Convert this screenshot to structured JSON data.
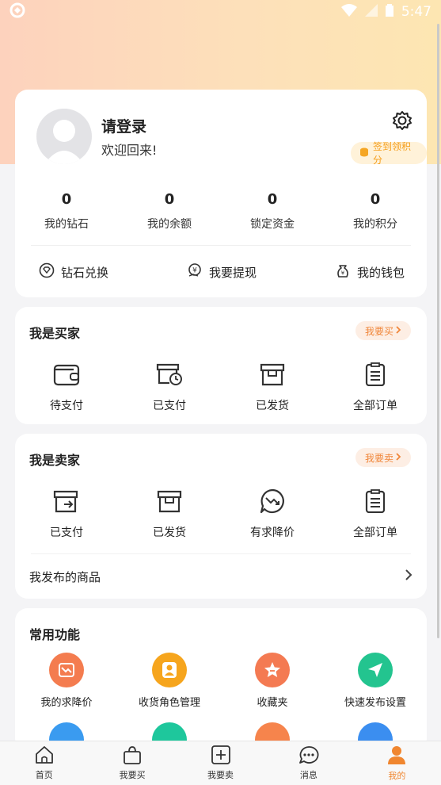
{
  "status": {
    "time": "5:47"
  },
  "user": {
    "login_label": "请登录",
    "welcome_text": "欢迎回来!",
    "sign_badge": "签到领积分",
    "stats": [
      {
        "value": "0",
        "label": "我的钻石"
      },
      {
        "value": "0",
        "label": "我的余额"
      },
      {
        "value": "0",
        "label": "锁定资金"
      },
      {
        "value": "0",
        "label": "我的积分"
      }
    ],
    "actions": [
      {
        "label": "钻石兑换",
        "icon": "diamond-icon"
      },
      {
        "label": "我要提现",
        "icon": "withdraw-icon"
      },
      {
        "label": "我的钱包",
        "icon": "wallet-icon"
      }
    ]
  },
  "buyer": {
    "title": "我是买家",
    "pill": "我要买",
    "items": [
      {
        "label": "待支付",
        "icon": "wallet-icon"
      },
      {
        "label": "已支付",
        "icon": "paid-clock-icon"
      },
      {
        "label": "已发货",
        "icon": "box-icon"
      },
      {
        "label": "全部订单",
        "icon": "order-list-icon"
      }
    ]
  },
  "seller": {
    "title": "我是卖家",
    "pill": "我要卖",
    "items": [
      {
        "label": "已支付",
        "icon": "paid-arrow-icon"
      },
      {
        "label": "已发货",
        "icon": "box-icon"
      },
      {
        "label": "有求降价",
        "icon": "price-drop-icon"
      },
      {
        "label": "全部订单",
        "icon": "order-list-icon"
      }
    ],
    "published_label": "我发布的商品"
  },
  "common": {
    "title": "常用功能",
    "items": [
      {
        "label": "我的求降价",
        "icon": "price-drop-icon",
        "color": "#f47c4f"
      },
      {
        "label": "收货角色管理",
        "icon": "person-icon",
        "color": "#f6a51d"
      },
      {
        "label": "收藏夹",
        "icon": "star-icon",
        "color": "#f47a52"
      },
      {
        "label": "快速发布设置",
        "icon": "send-icon",
        "color": "#23c48f"
      }
    ],
    "row2_colors": [
      "#3a9bf0",
      "#1ec79c",
      "#f6844c",
      "#3b8ef0"
    ]
  },
  "tabbar": {
    "tabs": [
      {
        "label": "首页",
        "icon": "home-icon"
      },
      {
        "label": "我要买",
        "icon": "shopping-bag-icon"
      },
      {
        "label": "我要卖",
        "icon": "plus-box-icon"
      },
      {
        "label": "消息",
        "icon": "message-icon"
      },
      {
        "label": "我的",
        "icon": "profile-icon"
      }
    ],
    "active_color": "#f0862f"
  }
}
